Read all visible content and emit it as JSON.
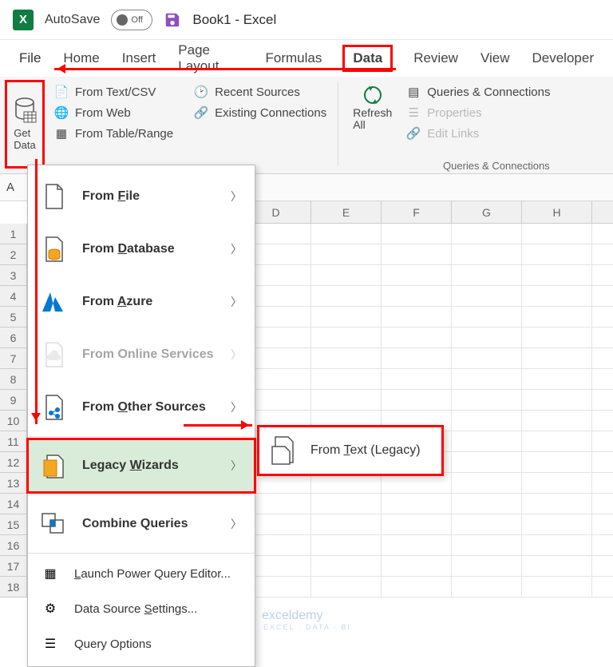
{
  "title_bar": {
    "autosave_label": "AutoSave",
    "autosave_state": "Off",
    "doc_title": "Book1 - Excel"
  },
  "ribbon_tabs": [
    "File",
    "Home",
    "Insert",
    "Page Layout",
    "Formulas",
    "Data",
    "Review",
    "View",
    "Developer"
  ],
  "ribbon_tabs_active": "Data",
  "ribbon": {
    "get_data_label": "Get\nData",
    "group1_items": [
      {
        "label": "From Text/CSV",
        "icon": "text-csv-icon"
      },
      {
        "label": "From Web",
        "icon": "web-icon"
      },
      {
        "label": "From Table/Range",
        "icon": "table-range-icon"
      }
    ],
    "group2_items": [
      {
        "label": "Recent Sources",
        "icon": "recent-icon"
      },
      {
        "label": "Existing Connections",
        "icon": "connections-icon"
      }
    ],
    "refresh_label": "Refresh\nAll",
    "qc_items": [
      {
        "label": "Queries & Connections",
        "enabled": true
      },
      {
        "label": "Properties",
        "enabled": false
      },
      {
        "label": "Edit Links",
        "enabled": false
      }
    ],
    "qc_group_label": "Queries & Connections"
  },
  "formula_bar": {
    "name_box": "A"
  },
  "columns": [
    "D",
    "E",
    "F",
    "G",
    "H"
  ],
  "rows": [
    "1",
    "2",
    "3",
    "4",
    "5",
    "6",
    "7",
    "8",
    "9",
    "10",
    "11",
    "12",
    "13",
    "14",
    "15",
    "16",
    "17",
    "18"
  ],
  "menu": {
    "items": [
      {
        "label": "From File",
        "underline": "F",
        "icon": "file-icon",
        "enabled": true,
        "arrow": true
      },
      {
        "label": "From Database",
        "underline": "D",
        "icon": "database-icon",
        "enabled": true,
        "arrow": true
      },
      {
        "label": "From Azure",
        "underline": "A",
        "icon": "azure-icon",
        "enabled": true,
        "arrow": true
      },
      {
        "label": "From Online Services",
        "underline": "",
        "icon": "cloud-icon",
        "enabled": false,
        "arrow": true
      },
      {
        "label": "From Other Sources",
        "underline": "O",
        "icon": "other-sources-icon",
        "enabled": true,
        "arrow": true
      },
      {
        "label": "Legacy Wizards",
        "underline": "W",
        "icon": "legacy-wizards-icon",
        "enabled": true,
        "arrow": true,
        "highlight": true
      },
      {
        "label": "Combine Queries",
        "underline": "",
        "icon": "combine-icon",
        "enabled": true,
        "arrow": true
      }
    ],
    "footer": [
      {
        "label": "Launch Power Query Editor...",
        "underline": "L",
        "icon": "pq-editor-icon"
      },
      {
        "label": "Data Source Settings...",
        "underline": "S",
        "icon": "data-source-icon"
      },
      {
        "label": "Query Options",
        "underline": "",
        "icon": "options-icon"
      }
    ]
  },
  "submenu": {
    "label": "From Text (Legacy)",
    "underline": "T",
    "icon": "from-text-icon"
  },
  "watermark": {
    "brand": "exceldemy",
    "tag": "EXCEL · DATA · BI"
  }
}
